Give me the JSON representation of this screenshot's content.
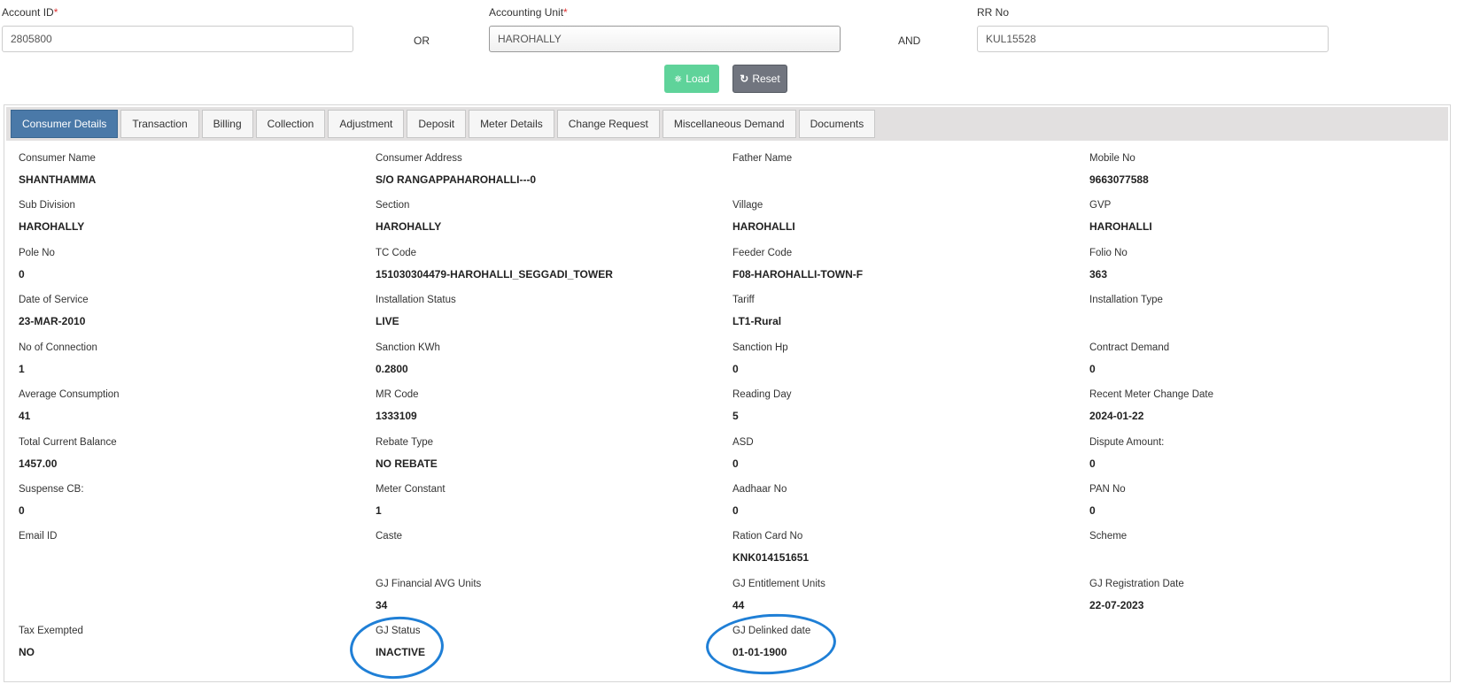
{
  "search": {
    "account_id_label": "Account ID",
    "account_id_value": "2805800",
    "or_text": "OR",
    "accounting_unit_label": "Accounting Unit",
    "accounting_unit_value": "HAROHALLY",
    "and_text": "AND",
    "rr_no_label": "RR No",
    "rr_no_value": "KUL15528",
    "required_mark": "*",
    "load_label": "Load",
    "reset_label": "Reset"
  },
  "tabs": [
    {
      "label": "Consumer Details",
      "active": true
    },
    {
      "label": "Transaction"
    },
    {
      "label": "Billing"
    },
    {
      "label": "Collection"
    },
    {
      "label": "Adjustment"
    },
    {
      "label": "Deposit"
    },
    {
      "label": "Meter Details"
    },
    {
      "label": "Change Request"
    },
    {
      "label": "Miscellaneous Demand"
    },
    {
      "label": "Documents"
    }
  ],
  "details": {
    "consumer_name": {
      "label": "Consumer Name",
      "value": "SHANTHAMMA"
    },
    "consumer_address": {
      "label": "Consumer Address",
      "value": "S/O RANGAPPAHAROHALLI---0"
    },
    "father_name": {
      "label": "Father Name",
      "value": ""
    },
    "mobile_no": {
      "label": "Mobile No",
      "value": "9663077588"
    },
    "sub_division": {
      "label": "Sub Division",
      "value": "HAROHALLY"
    },
    "section": {
      "label": "Section",
      "value": "HAROHALLY"
    },
    "village": {
      "label": "Village",
      "value": "HAROHALLI"
    },
    "gvp": {
      "label": "GVP",
      "value": "HAROHALLI"
    },
    "pole_no": {
      "label": "Pole No",
      "value": "0"
    },
    "tc_code": {
      "label": "TC Code",
      "value": "151030304479-HAROHALLI_SEGGADI_TOWER"
    },
    "feeder_code": {
      "label": "Feeder Code",
      "value": "F08-HAROHALLI-TOWN-F"
    },
    "folio_no": {
      "label": "Folio No",
      "value": "363"
    },
    "date_of_service": {
      "label": "Date of Service",
      "value": "23-MAR-2010"
    },
    "installation_status": {
      "label": "Installation Status",
      "value": "LIVE"
    },
    "tariff": {
      "label": "Tariff",
      "value": "LT1-Rural"
    },
    "installation_type": {
      "label": "Installation Type",
      "value": ""
    },
    "no_of_connection": {
      "label": "No of Connection",
      "value": "1"
    },
    "sanction_kwh": {
      "label": "Sanction KWh",
      "value": "0.2800"
    },
    "sanction_hp": {
      "label": "Sanction Hp",
      "value": "0"
    },
    "contract_demand": {
      "label": "Contract Demand",
      "value": "0"
    },
    "average_consumption": {
      "label": "Average Consumption",
      "value": "41"
    },
    "mr_code": {
      "label": "MR Code",
      "value": "1333109"
    },
    "reading_day": {
      "label": "Reading Day",
      "value": "5"
    },
    "recent_meter_change_date": {
      "label": "Recent Meter Change Date",
      "value": "2024-01-22"
    },
    "total_current_balance": {
      "label": "Total Current Balance",
      "value": "1457.00"
    },
    "rebate_type": {
      "label": "Rebate Type",
      "value": "NO REBATE"
    },
    "asd": {
      "label": "ASD",
      "value": "0"
    },
    "dispute_amount": {
      "label": "Dispute Amount:",
      "value": "0"
    },
    "suspense_cb": {
      "label": "Suspense CB:",
      "value": "0"
    },
    "meter_constant": {
      "label": "Meter Constant",
      "value": "1"
    },
    "aadhaar_no": {
      "label": "Aadhaar No",
      "value": "0"
    },
    "pan_no": {
      "label": "PAN No",
      "value": "0"
    },
    "email_id": {
      "label": "Email ID",
      "value": ""
    },
    "caste": {
      "label": "Caste",
      "value": ""
    },
    "ration_card_no": {
      "label": "Ration Card No",
      "value": "KNK014151651"
    },
    "scheme": {
      "label": "Scheme",
      "value": ""
    },
    "gj_financial_avg_units": {
      "label": "GJ Financial AVG Units",
      "value": "34"
    },
    "gj_entitlement_units": {
      "label": "GJ Entitlement Units",
      "value": "44"
    },
    "gj_registration_date": {
      "label": "GJ Registration Date",
      "value": "22-07-2023"
    },
    "tax_exempted": {
      "label": "Tax Exempted",
      "value": "NO"
    },
    "gj_status": {
      "label": "GJ Status",
      "value": "INACTIVE"
    },
    "gj_delinked_date": {
      "label": "GJ Delinked date",
      "value": "01-01-1900"
    }
  },
  "colors": {
    "active_tab": "#4a79a8",
    "load_button": "#5fd39a",
    "reset_button": "#71757f",
    "annotation_circle": "#1f7fd6"
  }
}
